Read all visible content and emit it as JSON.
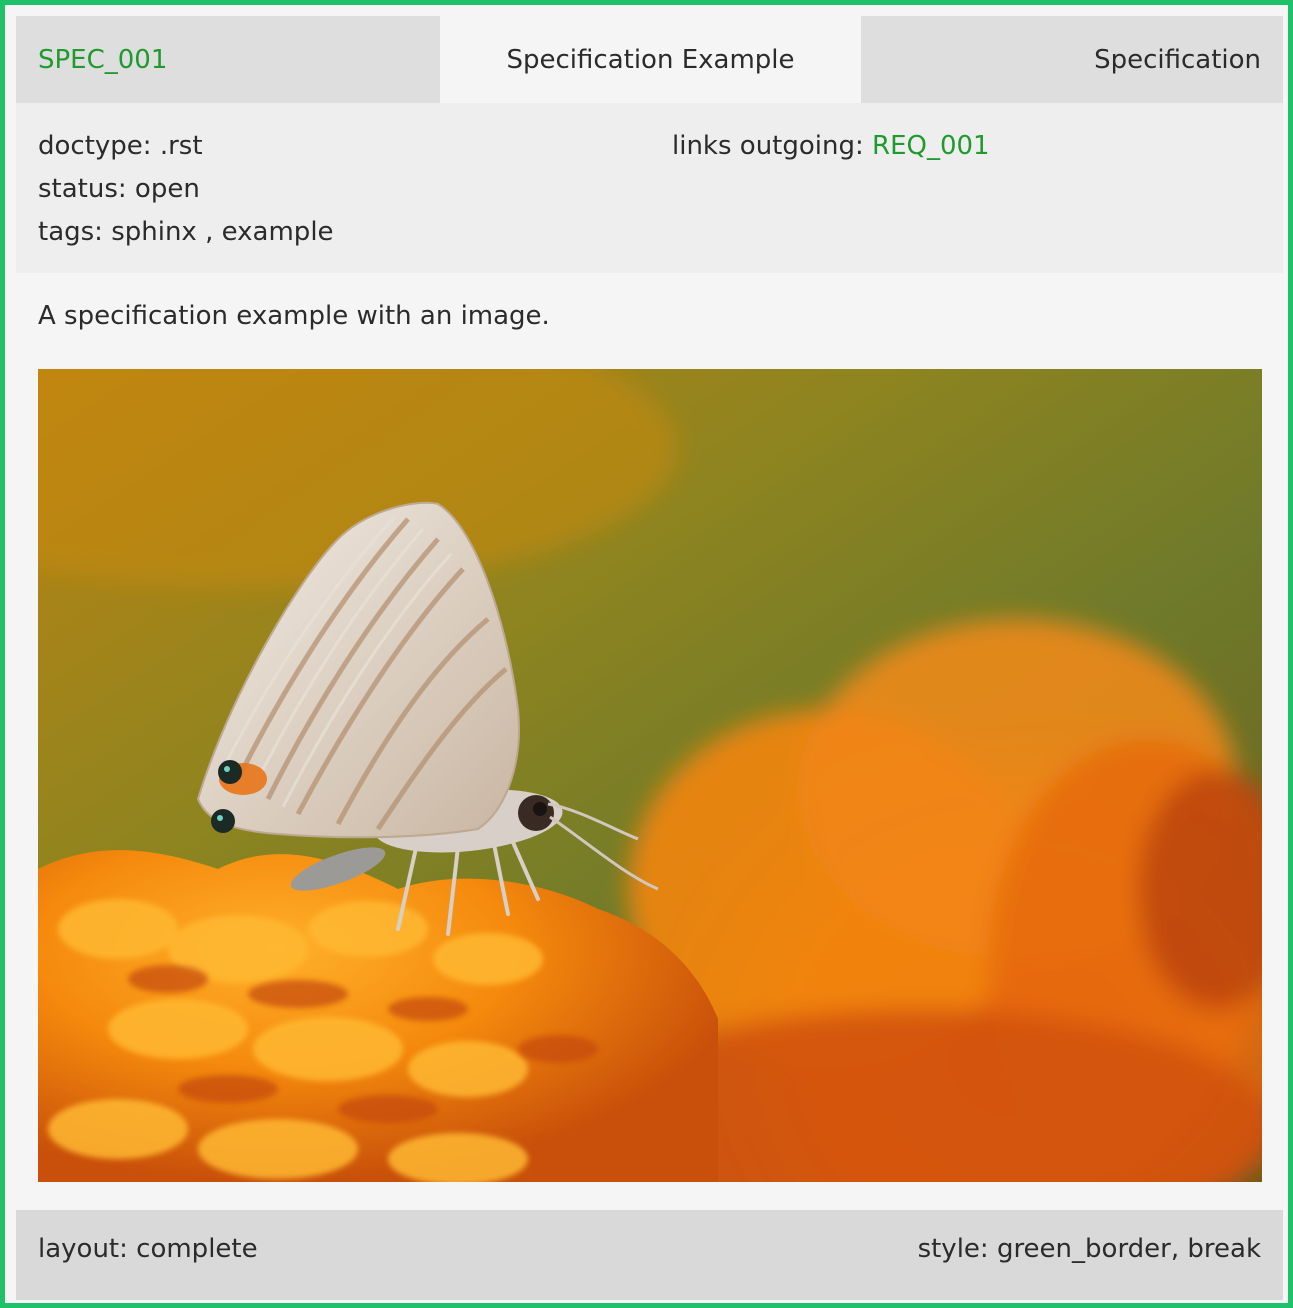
{
  "header": {
    "id": "SPEC_001",
    "title": "Specification Example",
    "type": "Specification"
  },
  "meta": {
    "doctype_label": "doctype: ",
    "doctype": ".rst",
    "status_label": "status: ",
    "status": "open",
    "tags_label": "tags: ",
    "tags": [
      "sphinx",
      "example"
    ],
    "links_label": "links outgoing: ",
    "links_outgoing": "REQ_001"
  },
  "content": {
    "description": "A specification example with an image."
  },
  "footer": {
    "layout_label": "layout: ",
    "layout": "complete",
    "style_label": "style: ",
    "style": "green_border, break"
  },
  "colors": {
    "border": "#1fc16b",
    "link": "#1f9a2f",
    "header_bg": "#dedede",
    "meta_bg": "#eeeeee",
    "footer_bg": "#d9d9d9"
  }
}
